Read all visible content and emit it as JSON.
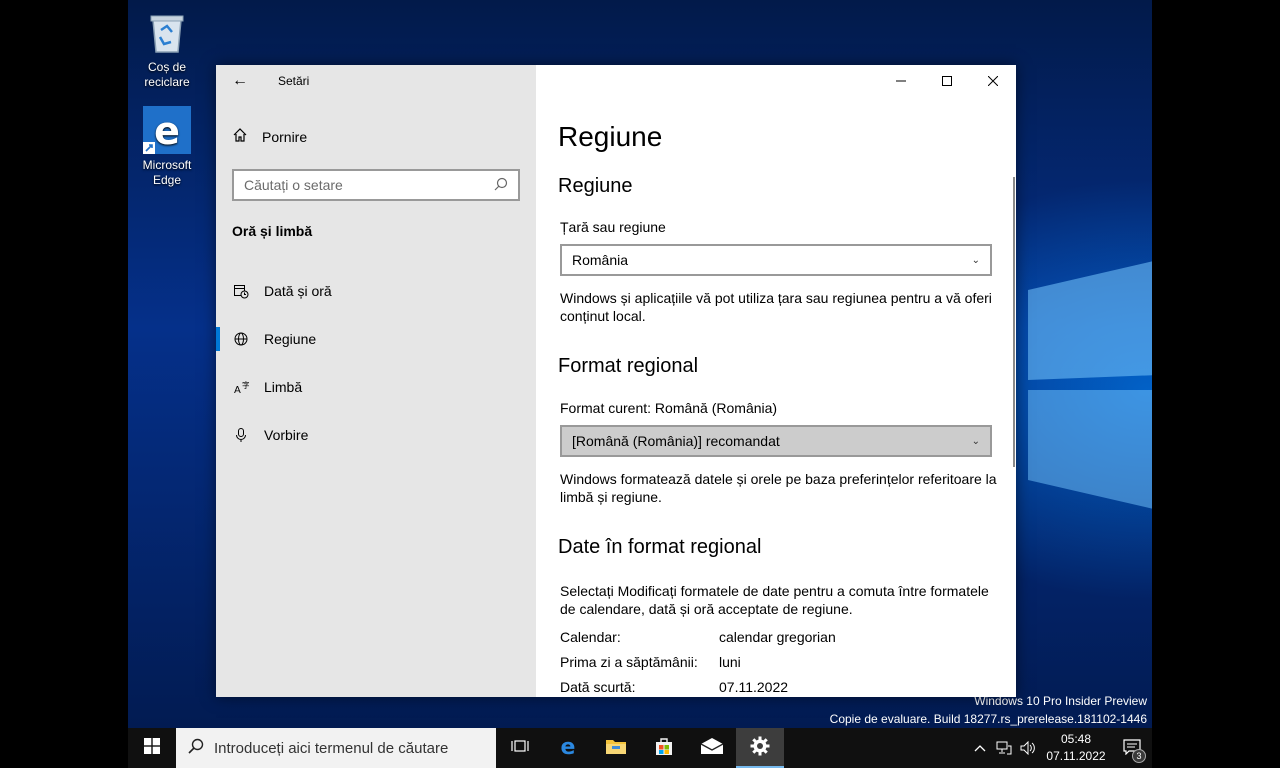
{
  "desktop": {
    "icons": [
      {
        "label_line1": "Coș de",
        "label_line2": "reciclare",
        "icon": "recycle-bin-icon"
      },
      {
        "label_line1": "Microsoft",
        "label_line2": "Edge",
        "icon": "edge-icon"
      }
    ],
    "watermark": {
      "line1": "Windows 10 Pro Insider Preview",
      "line2": "Copie de evaluare. Build 18277.rs_prerelease.181102-1446"
    }
  },
  "window": {
    "title": "Setări",
    "controls": {
      "minimize": "—",
      "maximize": "☐",
      "close": "✕"
    }
  },
  "sidebar": {
    "home_label": "Pornire",
    "search_placeholder": "Căutați o setare",
    "section_label": "Oră și limbă",
    "items": [
      {
        "label": "Dată și oră",
        "icon": "calendar-clock-icon",
        "active": false
      },
      {
        "label": "Regiune",
        "icon": "globe-icon",
        "active": true
      },
      {
        "label": "Limbă",
        "icon": "language-icon",
        "active": false
      },
      {
        "label": "Vorbire",
        "icon": "microphone-icon",
        "active": false
      }
    ]
  },
  "main": {
    "page_title": "Regiune",
    "region": {
      "heading": "Regiune",
      "country_label": "Țară sau regiune",
      "country_value": "România",
      "description": "Windows și aplicațiile vă pot utiliza țara sau regiunea pentru a vă oferi conținut local."
    },
    "format": {
      "heading": "Format regional",
      "current_label": "Format curent: Română (România)",
      "selected_value": "[Română (România)] recomandat",
      "description": "Windows formatează datele și orele pe baza preferințelor referitoare la limbă și regiune."
    },
    "dates": {
      "heading": "Date în format regional",
      "description": "Selectați Modificați formatele de date pentru a comuta între formatele de calendare, dată și oră acceptate de regiune.",
      "rows": [
        {
          "key": "Calendar:",
          "value": "calendar gregorian"
        },
        {
          "key": "Prima zi a săptămânii:",
          "value": "luni"
        },
        {
          "key": "Dată scurtă:",
          "value": "07.11.2022"
        }
      ]
    }
  },
  "taskbar": {
    "search_placeholder": "Introduceți aici termenul de căutare",
    "time": "05:48",
    "date": "07.11.2022",
    "notification_count": "3"
  },
  "colors": {
    "accent": "#0078d7",
    "sidebar_bg": "#e6e6e6",
    "taskbar_bg": "#101010"
  }
}
